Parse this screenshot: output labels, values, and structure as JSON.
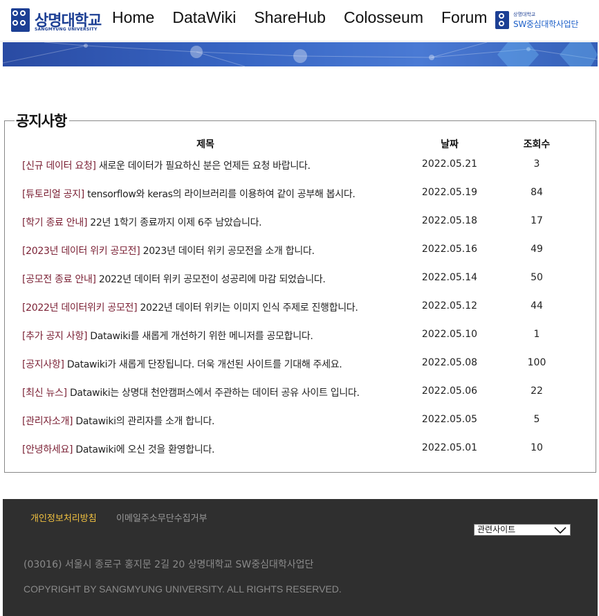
{
  "header": {
    "logo_name": "상명대학교",
    "logo_sub": "SANGMYUNG UNIVERSITY",
    "nav": [
      "Home",
      "DataWiki",
      "ShareHub",
      "Colosseum",
      "Forum"
    ],
    "sw_logo_top": "상명대학교",
    "sw_logo_bottom": "SW중심대학사업단"
  },
  "notice": {
    "title": "공지사항",
    "columns": {
      "title": "제목",
      "date": "날짜",
      "views": "조회수"
    },
    "rows": [
      {
        "tag": "[신규 데이터 요청]",
        "text": "새로운 데이터가 필요하신 분은 언제든 요청 바랍니다.",
        "date": "2022.05.21",
        "views": "3"
      },
      {
        "tag": "[튜토리얼 공지]",
        "text": "tensorflow와 keras의 라이브러리를 이용하여 같이 공부해 봅시다.",
        "date": "2022.05.19",
        "views": "84"
      },
      {
        "tag": "[학기 종료 안내]",
        "text": "22년 1학기 종료까지 이제 6주 남았습니다.",
        "date": "2022.05.18",
        "views": "17"
      },
      {
        "tag": "[2023년 데이터 위키 공모전]",
        "text": "2023년 데이터 위키 공모전을 소개 합니다.",
        "date": "2022.05.16",
        "views": "49"
      },
      {
        "tag": "[공모전 종료 안내]",
        "text": "2022년 데이터 위키 공모전이 성공리에 마감 되었습니다.",
        "date": "2022.05.14",
        "views": "50"
      },
      {
        "tag": "[2022년 데이터위키 공모전]",
        "text": "2022년 데이터 위키는 이미지 인식 주제로 진행합니다.",
        "date": "2022.05.12",
        "views": "44"
      },
      {
        "tag": "[추가 공지 사항]",
        "text": "Datawiki를 새롭게 개선하기 위한 메니저를 공모합니다.",
        "date": "2022.05.10",
        "views": "1"
      },
      {
        "tag": "[공지사항]",
        "text": "Datawiki가 새롭게 단장됩니다. 더욱 개선된 사이트를 기대해 주세요.",
        "date": "2022.05.08",
        "views": "100"
      },
      {
        "tag": "[최신 뉴스]",
        "text": "Datawiki는 상명대 천안캠퍼스에서 주관하는 데이터 공유 사이트 입니다.",
        "date": "2022.05.06",
        "views": "22"
      },
      {
        "tag": "[관리자소개]",
        "text": "Datawiki의 관리자를 소개 합니다.",
        "date": "2022.05.05",
        "views": "5"
      },
      {
        "tag": "[안녕하세요]",
        "text": "Datawiki에 오신 것을 환영합니다.",
        "date": "2022.05.01",
        "views": "10"
      }
    ]
  },
  "footer": {
    "privacy_link": "개인정보처리방침",
    "email_link": "이메일주소무단수집거부",
    "related_sites": "관련사이트",
    "address": "(03016) 서울시 종로구 홍지문 2길 20 상명대학교 SW중심대학사업단",
    "copyright": "COPYRIGHT BY SANGMYUNG UNIVERSITY. ALL RIGHTS RESERVED."
  },
  "colors": {
    "brand": "#1c3f94",
    "tag": "#7a1f33",
    "footer_bg": "#2f2f2f",
    "footer_highlight": "#f0c040"
  },
  "icons": {
    "logo": "university-seal-icon",
    "select": "chevron-down-icon"
  }
}
